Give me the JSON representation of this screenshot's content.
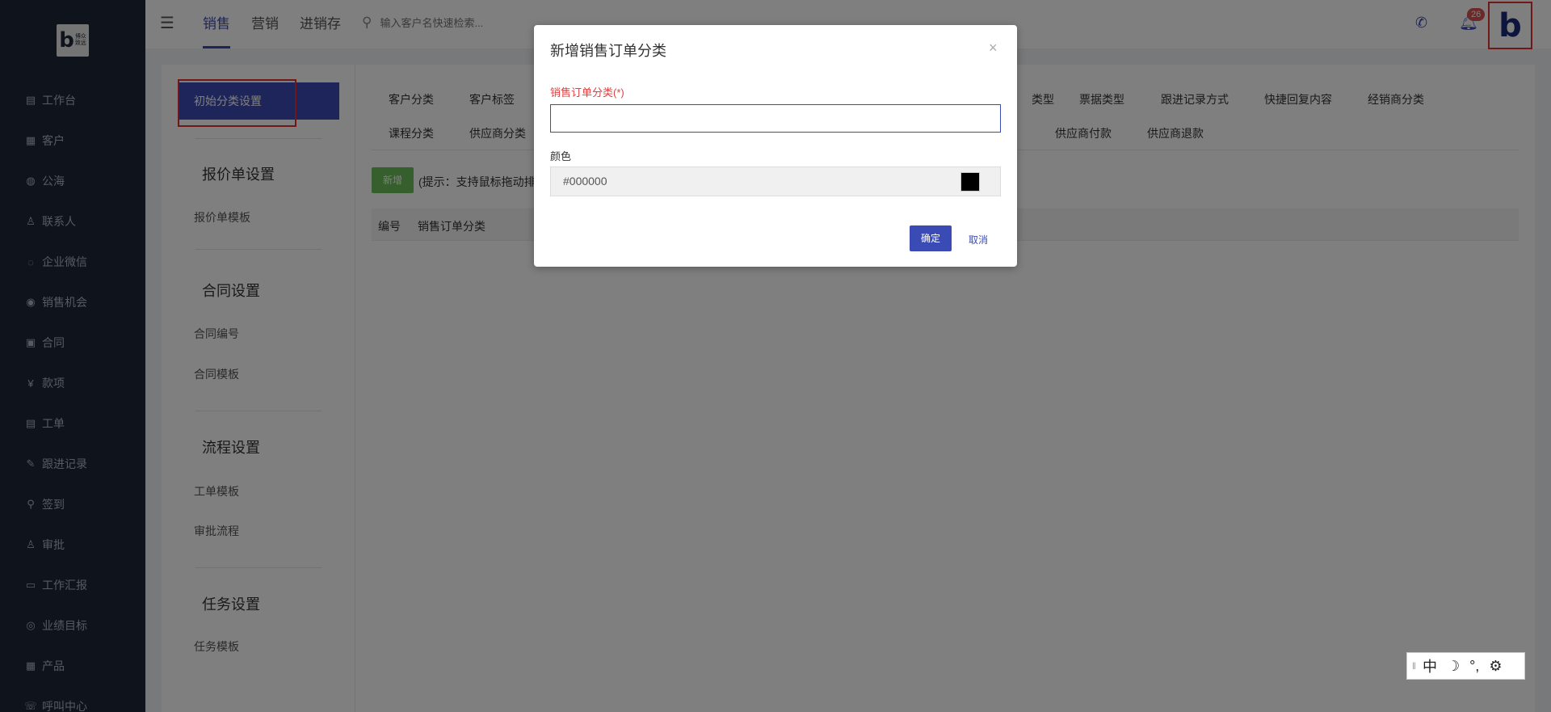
{
  "logo": {
    "mark": "b",
    "text_line1": "博众",
    "text_line2": "致远"
  },
  "sidebar": {
    "items": [
      {
        "label": "工作台",
        "icon": "▤"
      },
      {
        "label": "客户",
        "icon": "▦"
      },
      {
        "label": "公海",
        "icon": "◍"
      },
      {
        "label": "联系人",
        "icon": "♙"
      },
      {
        "label": "企业微信",
        "icon": "◌"
      },
      {
        "label": "销售机会",
        "icon": "◉"
      },
      {
        "label": "合同",
        "icon": "▣"
      },
      {
        "label": "款项",
        "icon": "¥"
      },
      {
        "label": "工单",
        "icon": "▤"
      },
      {
        "label": "跟进记录",
        "icon": "✎"
      },
      {
        "label": "签到",
        "icon": "⚲"
      },
      {
        "label": "审批",
        "icon": "♙"
      },
      {
        "label": "工作汇报",
        "icon": "▭"
      },
      {
        "label": "业绩目标",
        "icon": "◎"
      },
      {
        "label": "产品",
        "icon": "▦"
      },
      {
        "label": "呼叫中心",
        "icon": "☏"
      }
    ]
  },
  "topbar": {
    "menu_icon": "☰",
    "tabs": [
      "销售",
      "营销",
      "进销存"
    ],
    "search_placeholder": "输入客户名快速检索...",
    "notification_count": "26",
    "avatar_letter": "b"
  },
  "settings_panel": {
    "active_item": "初始分类设置",
    "sections": [
      {
        "title": "报价单设置",
        "items": [
          "报价单模板"
        ]
      },
      {
        "title": "合同设置",
        "items": [
          "合同编号",
          "合同模板"
        ]
      },
      {
        "title": "流程设置",
        "items": [
          "工单模板",
          "审批流程"
        ]
      },
      {
        "title": "任务设置",
        "items": [
          "任务模板"
        ]
      }
    ]
  },
  "categories": {
    "row1_left": [
      "客户分类",
      "客户标签"
    ],
    "row1_right": [
      "类型",
      "票据类型",
      "跟进记录方式",
      "快捷回复内容",
      "经销商分类"
    ],
    "row2_left": [
      "课程分类",
      "供应商分类"
    ],
    "row2_right": [
      "供应商付款",
      "供应商退款"
    ]
  },
  "toolbar": {
    "new_label": "新增",
    "hint": "(提示：支持鼠标拖动排"
  },
  "table": {
    "headers": [
      "编号",
      "销售订单分类"
    ]
  },
  "dialog": {
    "title": "新增销售订单分类",
    "close": "×",
    "field_label": "销售订单分类(*)",
    "field_value": "",
    "color_label": "颜色",
    "color_value": "#000000",
    "ok_label": "确定",
    "cancel_label": "取消"
  },
  "ime_bar": {
    "items": [
      "中",
      "☽",
      "°,",
      "⚙"
    ]
  }
}
